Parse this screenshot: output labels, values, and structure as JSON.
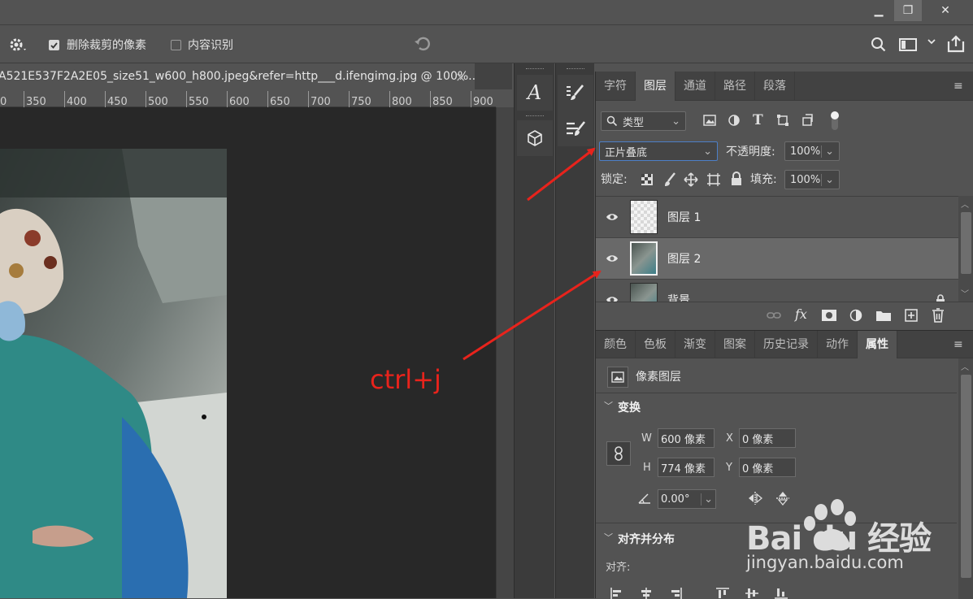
{
  "window": {
    "minimize": "▁",
    "restore": "❐",
    "close": "✕"
  },
  "options_bar": {
    "delete_cropped_label": "删除裁剪的像素",
    "delete_cropped_checked": true,
    "content_aware_label": "内容识别",
    "content_aware_checked": false
  },
  "document": {
    "tab_title": "A521E537F2A2E05_size51_w600_h800.jpeg&refer=http___d.ifengimg.jpg @ 100%...",
    "close_icon": "×",
    "ruler_ticks": [
      "0",
      "350",
      "400",
      "450",
      "500",
      "550",
      "600",
      "650",
      "700",
      "750",
      "800",
      "850",
      "900"
    ]
  },
  "layers_panel": {
    "tabs": [
      "字符",
      "图层",
      "通道",
      "路径",
      "段落"
    ],
    "active_tab": "图层",
    "filter_kind": "类型",
    "blend_mode": "正片叠底",
    "opacity_label": "不透明度:",
    "opacity_value": "100%",
    "lock_label": "锁定:",
    "fill_label": "填充:",
    "fill_value": "100%",
    "layers": [
      {
        "name": "图层 1",
        "selected": false
      },
      {
        "name": "图层 2",
        "selected": true
      },
      {
        "name": "背景",
        "selected": false
      }
    ]
  },
  "properties_panel": {
    "tabs": [
      "颜色",
      "色板",
      "渐变",
      "图案",
      "历史记录",
      "动作",
      "属性"
    ],
    "active_tab": "属性",
    "kind": "像素图层",
    "transform_title": "变换",
    "w_label": "W",
    "w_value": "600 像素",
    "h_label": "H",
    "h_value": "774 像素",
    "x_label": "X",
    "x_value": "0 像素",
    "y_label": "Y",
    "y_value": "0 像素",
    "angle_value": "0.00°",
    "align_title": "对齐并分布",
    "align_label": "对齐:"
  },
  "annotation": {
    "text": "ctrl+j",
    "color": "#e8231c"
  },
  "watermark": {
    "brand": "Bai du 经验",
    "url": "jingyan.baidu.com"
  }
}
